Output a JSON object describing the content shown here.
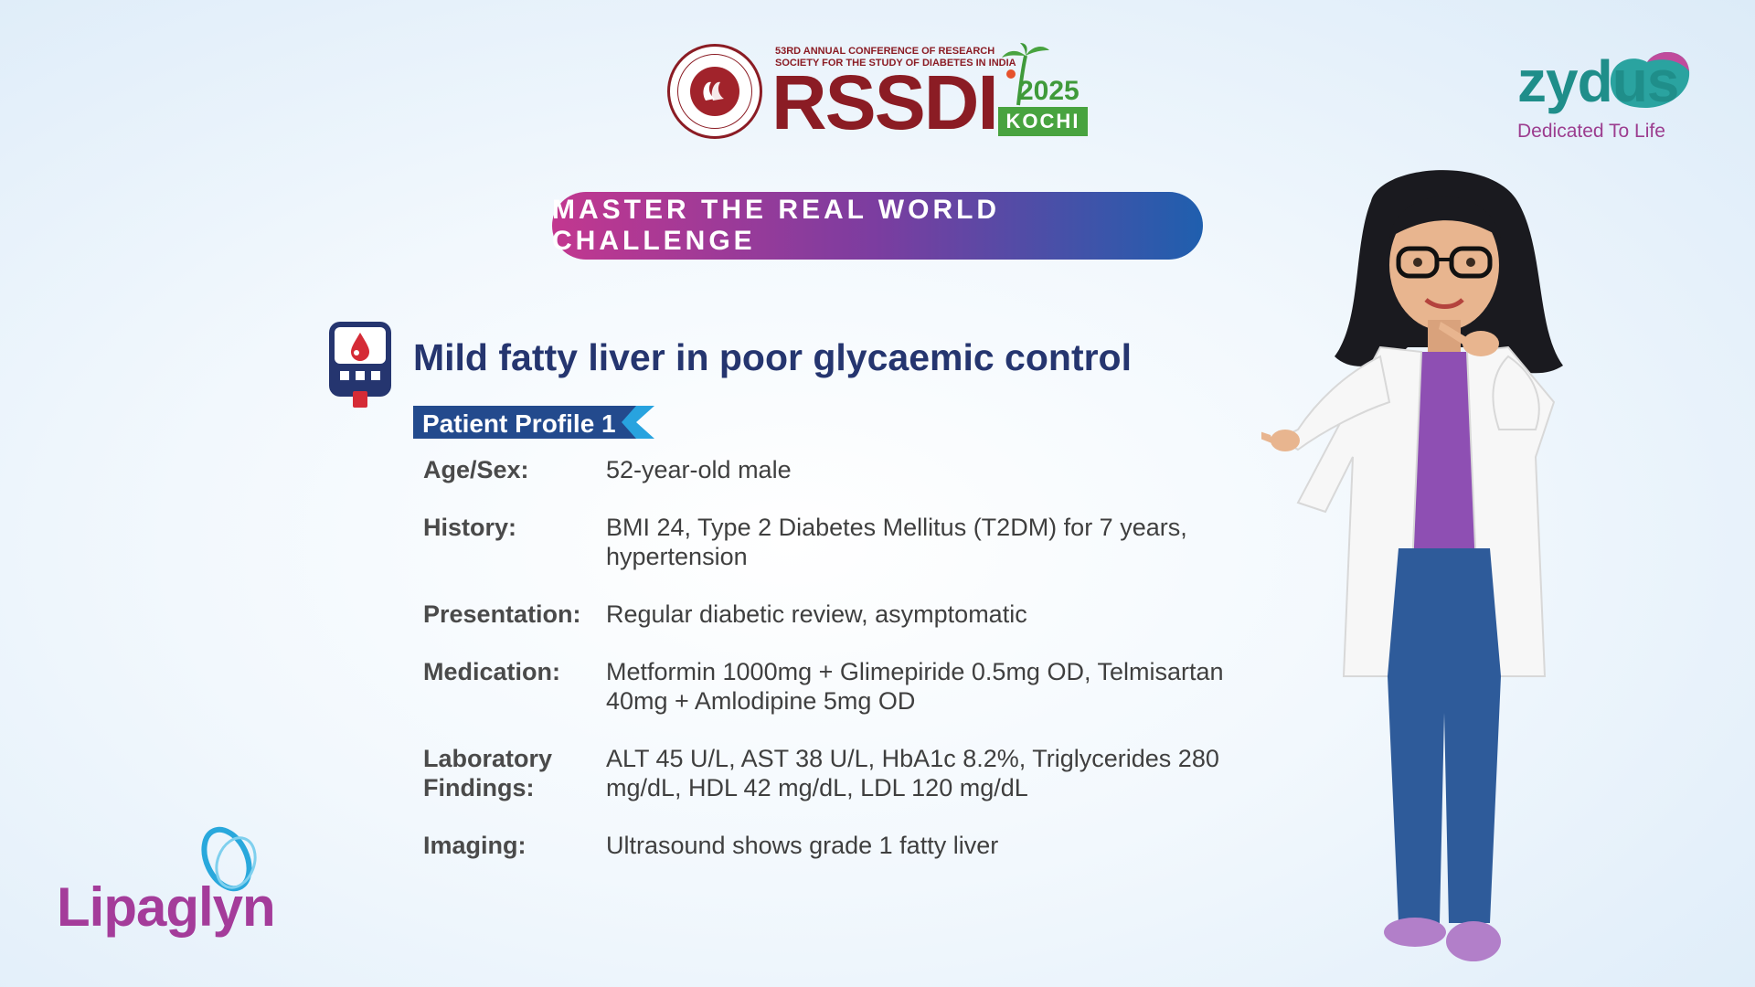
{
  "header": {
    "conference_line_1": "53rd Annual Conference of Research",
    "conference_line_2": "Society for the Study of Diabetes in India",
    "org_acronym": "RSSDI",
    "year": "2025",
    "city": "KOCHI"
  },
  "sponsor": {
    "name": "zydus",
    "tagline": "Dedicated To Life"
  },
  "banner": {
    "text": "MASTER THE REAL WORLD CHALLENGE"
  },
  "case": {
    "title": "Mild fatty liver in poor glycaemic control",
    "profile_label": "Patient Profile 1",
    "rows": [
      {
        "label": "Age/Sex:",
        "value": "52-year-old male"
      },
      {
        "label": "History:",
        "value": "BMI 24, Type 2 Diabetes Mellitus (T2DM) for 7 years, hypertension"
      },
      {
        "label": "Presentation:",
        "value": "Regular diabetic review, asymptomatic"
      },
      {
        "label": "Medication:",
        "value": "Metformin 1000mg + Glimepiride 0.5mg OD, Telmisartan 40mg + Amlodipine 5mg OD"
      },
      {
        "label": "Laboratory Findings:",
        "value": "ALT 45 U/L, AST 38 U/L, HbA1c 8.2%, Triglycerides 280 mg/dL, HDL 42 mg/dL, LDL 120 mg/dL"
      },
      {
        "label": "Imaging:",
        "value": "Ultrasound shows grade 1 fatty liver"
      }
    ]
  },
  "product": {
    "name": "Lipaglyn"
  },
  "colors": {
    "navy": "#25356f",
    "rssdi_red": "#8b1c24",
    "zydus_teal": "#1f8e8a",
    "brand_purple": "#a43c9a",
    "profile_blue": "#234a8d"
  }
}
